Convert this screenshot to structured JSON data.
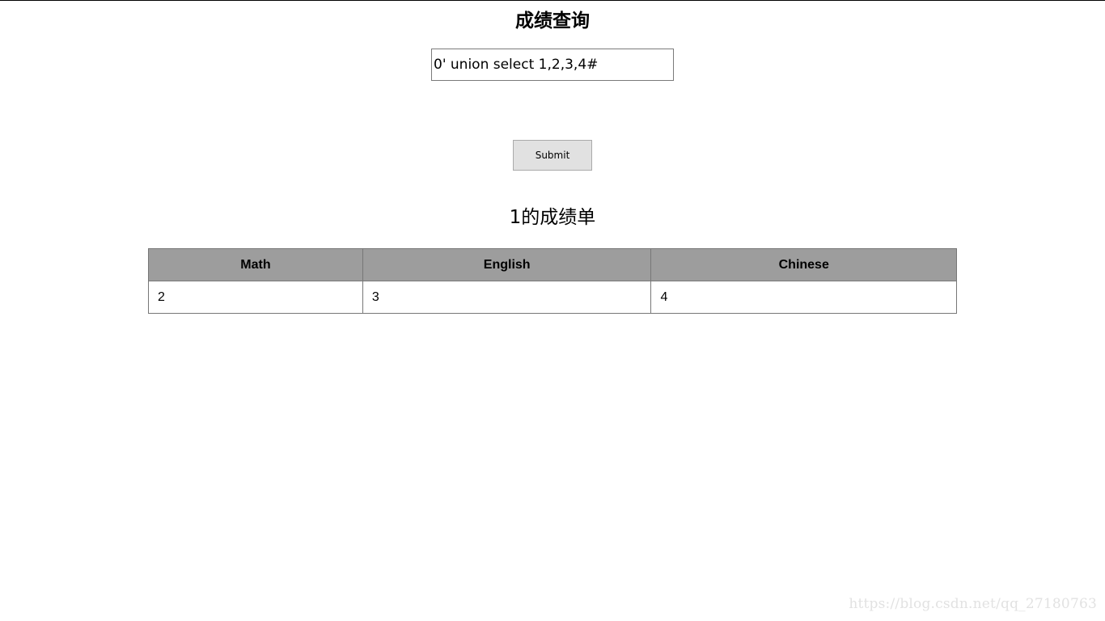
{
  "page": {
    "title": "成绩查询",
    "search": {
      "value": "0' union select 1,2,3,4#",
      "placeholder": ""
    },
    "submit_label": "Submit"
  },
  "result": {
    "title": "1的成绩单",
    "columns": [
      "Math",
      "English",
      "Chinese"
    ],
    "rows": [
      [
        "2",
        "3",
        "4"
      ]
    ]
  },
  "watermark": "https://blog.csdn.net/qq_27180763"
}
